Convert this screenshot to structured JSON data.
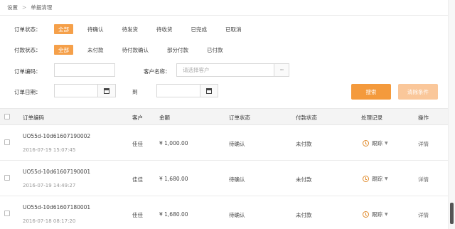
{
  "breadcrumb": {
    "home": "设置",
    "separator": ">",
    "current": "单据清理"
  },
  "order_status": {
    "label": "订单状态：",
    "chips": [
      "全部",
      "待确认",
      "待发货",
      "待收货",
      "已完成",
      "已取消"
    ]
  },
  "payment_status": {
    "label": "付款状态：",
    "chips": [
      "全部",
      "未付款",
      "待付款确认",
      "部分付款",
      "已付款"
    ]
  },
  "form": {
    "order_no_label": "订单编码：",
    "customer_label": "客户名称：",
    "customer_placeholder": "请选择客户",
    "customer_picker": "···",
    "date_label": "订单日期：",
    "date_to": "到",
    "search_button": "搜索",
    "clear_button": "清除条件"
  },
  "table": {
    "headers": {
      "order_no": "订单编码",
      "customer": "客户",
      "amount": "金额",
      "order_status": "订单状态",
      "payment_status": "付款状态",
      "history": "处理记录",
      "action": "操作"
    },
    "rows": [
      {
        "order_no": "UO55d-10d61607190002",
        "time": "2016-07-19 15:07:45",
        "customer": "佳佳",
        "amount": "¥ 1,000.00",
        "order_status": "待确认",
        "payment_status": "未付款",
        "track": "跟踪",
        "action": "详情"
      },
      {
        "order_no": "UO55d-10d61607190001",
        "time": "2016-07-19 14:49:27",
        "customer": "佳佳",
        "amount": "¥ 1,680.00",
        "order_status": "待确认",
        "payment_status": "未付款",
        "track": "跟踪",
        "action": "详情"
      },
      {
        "order_no": "UO55d-10d61607180001",
        "time": "2016-07-18 08:17:20",
        "customer": "佳佳",
        "amount": "¥ 1,680.00",
        "order_status": "待确认",
        "payment_status": "未付款",
        "track": "跟踪",
        "action": "详情"
      }
    ]
  },
  "colors": {
    "accent": "#f49a3c",
    "accent_light": "#fac79a",
    "header_bg": "#f4f4f4"
  },
  "icons": {
    "calendar": "calendar-icon",
    "clock": "clock-icon",
    "caret": "chevron-down-icon"
  }
}
